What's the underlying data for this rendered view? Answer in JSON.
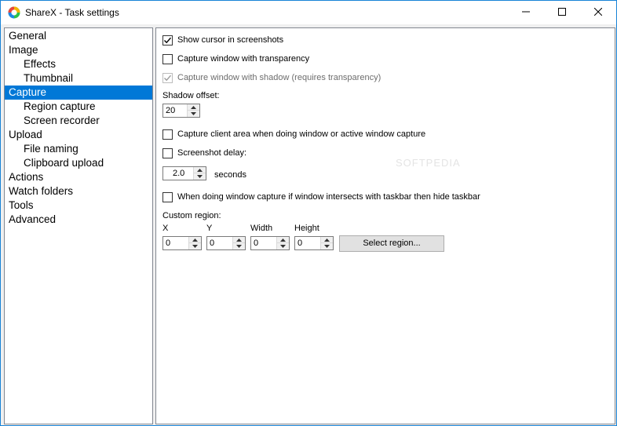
{
  "window": {
    "title": "ShareX - Task settings",
    "controls": {
      "minimize_icon": "minimize-icon",
      "maximize_icon": "maximize-icon",
      "close_icon": "close-icon"
    }
  },
  "sidebar": {
    "items": [
      {
        "label": "General",
        "level": 0,
        "selected": false
      },
      {
        "label": "Image",
        "level": 0,
        "selected": false
      },
      {
        "label": "Effects",
        "level": 1,
        "selected": false
      },
      {
        "label": "Thumbnail",
        "level": 1,
        "selected": false
      },
      {
        "label": "Capture",
        "level": 0,
        "selected": true
      },
      {
        "label": "Region capture",
        "level": 1,
        "selected": false
      },
      {
        "label": "Screen recorder",
        "level": 1,
        "selected": false
      },
      {
        "label": "Upload",
        "level": 0,
        "selected": false
      },
      {
        "label": "File naming",
        "level": 1,
        "selected": false
      },
      {
        "label": "Clipboard upload",
        "level": 1,
        "selected": false
      },
      {
        "label": "Actions",
        "level": 0,
        "selected": false
      },
      {
        "label": "Watch folders",
        "level": 0,
        "selected": false
      },
      {
        "label": "Tools",
        "level": 0,
        "selected": false
      },
      {
        "label": "Advanced",
        "level": 0,
        "selected": false
      }
    ],
    "selected_color": "#0078d7"
  },
  "capture": {
    "show_cursor": {
      "label": "Show cursor in screenshots",
      "checked": true
    },
    "window_transparency": {
      "label": "Capture window with transparency",
      "checked": false
    },
    "window_shadow": {
      "label": "Capture window with shadow (requires transparency)",
      "checked": true,
      "disabled": true
    },
    "shadow_offset": {
      "label": "Shadow offset:",
      "value": "20"
    },
    "client_area": {
      "label": "Capture client area when doing window or active window capture",
      "checked": false
    },
    "screenshot_delay": {
      "label": "Screenshot delay:",
      "checked": false,
      "value": "2.0",
      "unit": "seconds"
    },
    "hide_taskbar": {
      "label": "When doing window capture if window intersects with taskbar then hide taskbar",
      "checked": false
    },
    "custom_region": {
      "label": "Custom region:",
      "x": {
        "label": "X",
        "value": "0"
      },
      "y": {
        "label": "Y",
        "value": "0"
      },
      "width": {
        "label": "Width",
        "value": "0"
      },
      "height": {
        "label": "Height",
        "value": "0"
      },
      "select_button": "Select region..."
    }
  },
  "watermark": "SOFTPEDIA"
}
